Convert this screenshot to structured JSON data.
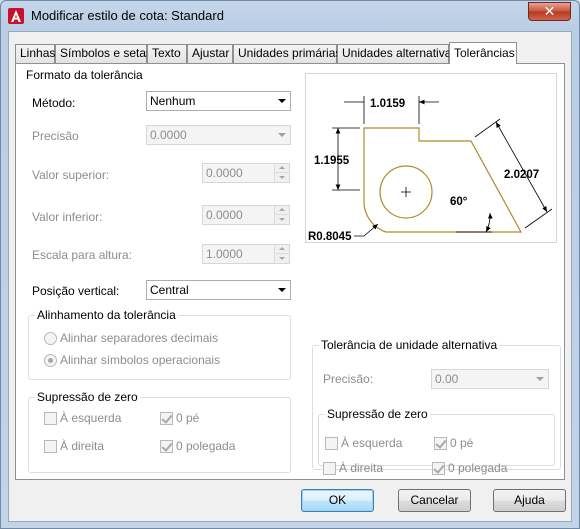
{
  "window": {
    "title": "Modificar estilo de cota: Standard",
    "close_glyph": "✕"
  },
  "tabs": [
    {
      "label": "Linhas"
    },
    {
      "label": "Símbolos e setas"
    },
    {
      "label": "Texto"
    },
    {
      "label": "Ajustar"
    },
    {
      "label": "Unidades primárias"
    },
    {
      "label": "Unidades alternativas"
    },
    {
      "label": "Tolerâncias",
      "active": true
    }
  ],
  "format": {
    "title": "Formato da tolerância",
    "method_label": "Método:",
    "method_value": "Nenhum",
    "precision_label": "Precisão",
    "precision_value": "0.0000",
    "upper_label": "Valor superior:",
    "upper_value": "0.0000",
    "lower_label": "Valor inferior:",
    "lower_value": "0.0000",
    "height_label": "Escala para altura:",
    "height_value": "1.0000",
    "vpos_label": "Posição vertical:",
    "vpos_value": "Central"
  },
  "alignment": {
    "title": "Alinhamento da tolerância",
    "option1": "Alinhar separadores decimais",
    "option2": "Alinhar símbolos operacionais"
  },
  "zero_left": {
    "title": "Supressão de zero",
    "leading": "À esquerda",
    "trailing": "À direita",
    "feet": "0 pé",
    "inches": "0 polegada"
  },
  "alt_units": {
    "title": "Tolerância de unidade alternativa",
    "precision_label": "Precisão:",
    "precision_value": "0.00",
    "zero_title": "Supressão de zero",
    "leading": "À esquerda",
    "trailing": "À direita",
    "feet": "0 pé",
    "inches": "0 polegada"
  },
  "preview": {
    "dim_top": "1.0159",
    "dim_left": "1.1955",
    "dim_right": "2.0207",
    "angle": "60°",
    "radius": "R0.8045",
    "line_color": "#b08a2a"
  },
  "buttons": {
    "ok": "OK",
    "cancel": "Cancelar",
    "help": "Ajuda"
  }
}
